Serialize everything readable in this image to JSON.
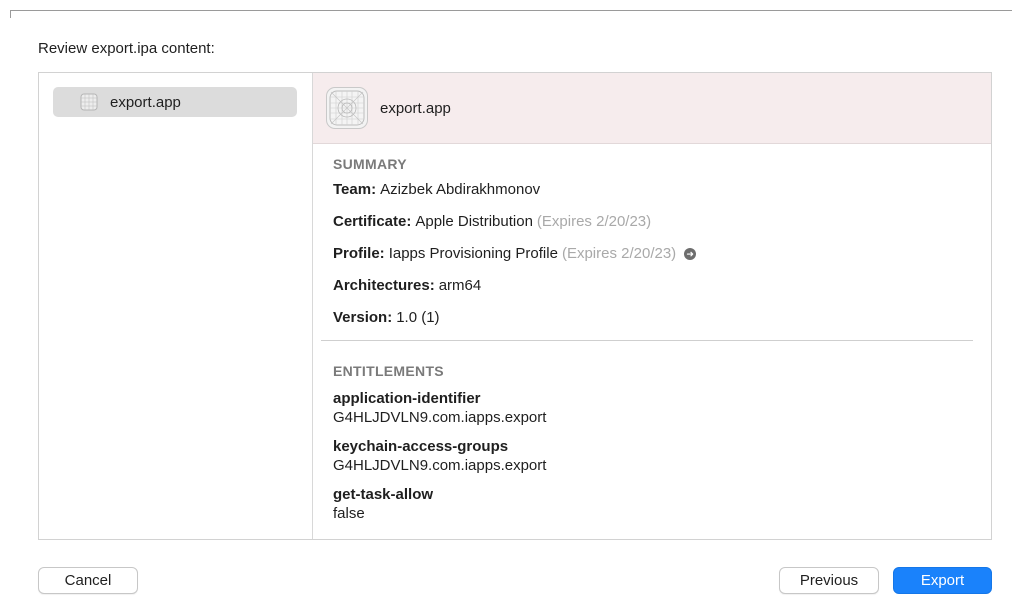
{
  "prompt": "Review export.ipa content:",
  "sidebar": {
    "items": [
      {
        "label": "export.app",
        "icon": "app-grid-icon"
      }
    ]
  },
  "detail": {
    "title": "export.app",
    "icon": "app-blueprint-icon",
    "summary": {
      "heading": "SUMMARY",
      "team": {
        "key": "Team:",
        "value": "Azizbek Abdirakhmonov"
      },
      "certificate": {
        "key": "Certificate:",
        "value": "Apple Distribution",
        "note": "(Expires 2/20/23)"
      },
      "profile": {
        "key": "Profile:",
        "value": "Iapps Provisioning Profile",
        "note": "(Expires 2/20/23)",
        "icon": "arrow-circle-right-icon"
      },
      "architectures": {
        "key": "Architectures:",
        "value": "arm64"
      },
      "version": {
        "key": "Version:",
        "value": "1.0 (1)"
      }
    },
    "entitlements": {
      "heading": "ENTITLEMENTS",
      "items": [
        {
          "key": "application-identifier",
          "value": "G4HLJDVLN9.com.iapps.export"
        },
        {
          "key": "keychain-access-groups",
          "value": "G4HLJDVLN9.com.iapps.export"
        },
        {
          "key": "get-task-allow",
          "value": "false"
        }
      ]
    }
  },
  "buttons": {
    "cancel": "Cancel",
    "previous": "Previous",
    "export": "Export"
  },
  "colors": {
    "accent": "#1a82fb",
    "header_bg": "#f6eced",
    "selection": "#dcdcdc"
  }
}
